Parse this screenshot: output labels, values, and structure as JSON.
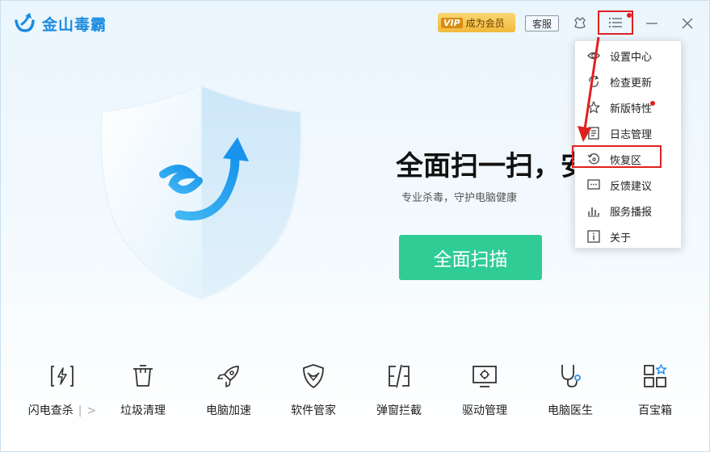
{
  "app": {
    "name": "金山毒霸"
  },
  "titlebar": {
    "vip_tag": "VIP",
    "vip_label": "成为会员",
    "kefu_label": "客服",
    "icons": [
      "logo-icon",
      "skin-icon",
      "menu-icon",
      "minimize-icon",
      "close-icon"
    ]
  },
  "hero": {
    "title": "全面扫一扫，安",
    "subtitle": "专业杀毒，守护电脑健康",
    "scan_button": "全面扫描"
  },
  "menu": {
    "items": [
      {
        "label": "设置中心",
        "icon": "settings-icon"
      },
      {
        "label": "检查更新",
        "icon": "update-icon"
      },
      {
        "label": "新版特性",
        "icon": "star-icon"
      },
      {
        "label": "日志管理",
        "icon": "log-icon"
      },
      {
        "label": "恢复区",
        "icon": "restore-icon",
        "highlighted": true
      },
      {
        "label": "反馈建议",
        "icon": "feedback-icon"
      },
      {
        "label": "服务播报",
        "icon": "report-icon"
      },
      {
        "label": "关于",
        "icon": "info-icon"
      }
    ]
  },
  "tools": [
    {
      "label": "闪电查杀",
      "icon": "lightning-scan-icon",
      "sep": "|",
      "more": ">"
    },
    {
      "label": "垃圾清理",
      "icon": "trash-icon"
    },
    {
      "label": "电脑加速",
      "icon": "rocket-icon"
    },
    {
      "label": "软件管家",
      "icon": "software-shield-icon"
    },
    {
      "label": "弹窗拦截",
      "icon": "popup-block-icon"
    },
    {
      "label": "驱动管理",
      "icon": "driver-monitor-icon"
    },
    {
      "label": "电脑医生",
      "icon": "stethoscope-icon"
    },
    {
      "label": "百宝箱",
      "icon": "toolbox-icon"
    }
  ],
  "colors": {
    "brand": "#1a8be0",
    "scan_button": "#2fcc95",
    "annotation": "#e02020",
    "vip_gold": "#f2b93b"
  }
}
